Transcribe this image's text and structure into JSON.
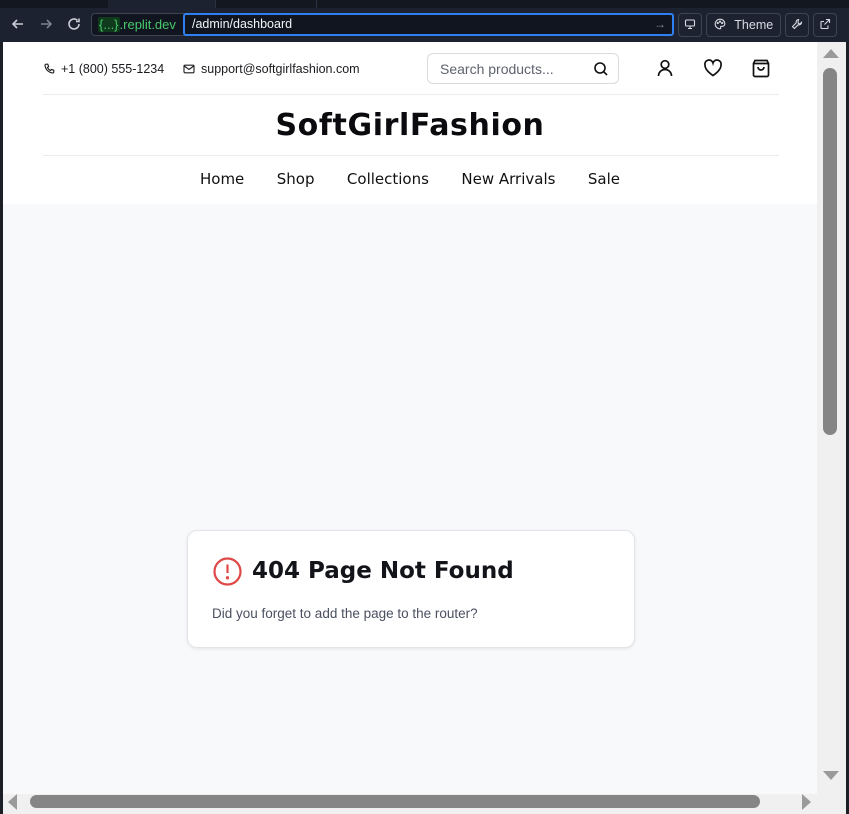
{
  "browser": {
    "host_brace": "{...}",
    "host_domain": ".replit.dev",
    "url_path": "/admin/dashboard",
    "theme_label": "Theme",
    "icons": [
      "back-arrow-icon",
      "forward-arrow-icon",
      "reload-icon",
      "go-arrow-icon",
      "devices-icon",
      "palette-icon",
      "wrench-icon",
      "external-link-icon"
    ]
  },
  "header": {
    "phone": "+1 (800) 555-1234",
    "email": "support@softgirlfashion.com",
    "search_placeholder": "Search products...",
    "brand": "SoftGirlFashion",
    "icons": [
      "phone-icon",
      "mail-icon",
      "search-icon",
      "user-icon",
      "heart-icon",
      "shopping-bag-icon"
    ]
  },
  "nav": {
    "items": [
      {
        "label": "Home"
      },
      {
        "label": "Shop"
      },
      {
        "label": "Collections"
      },
      {
        "label": "New Arrivals"
      },
      {
        "label": "Sale"
      }
    ]
  },
  "not_found": {
    "title": "404 Page Not Found",
    "message": "Did you forget to add the page to the router?",
    "icon": "alert-circle-icon",
    "icon_color": "#e04848"
  },
  "colors": {
    "url_focus": "#2f7ff0",
    "host_green": "#48c96b",
    "page_bg": "#f8f9fa"
  }
}
